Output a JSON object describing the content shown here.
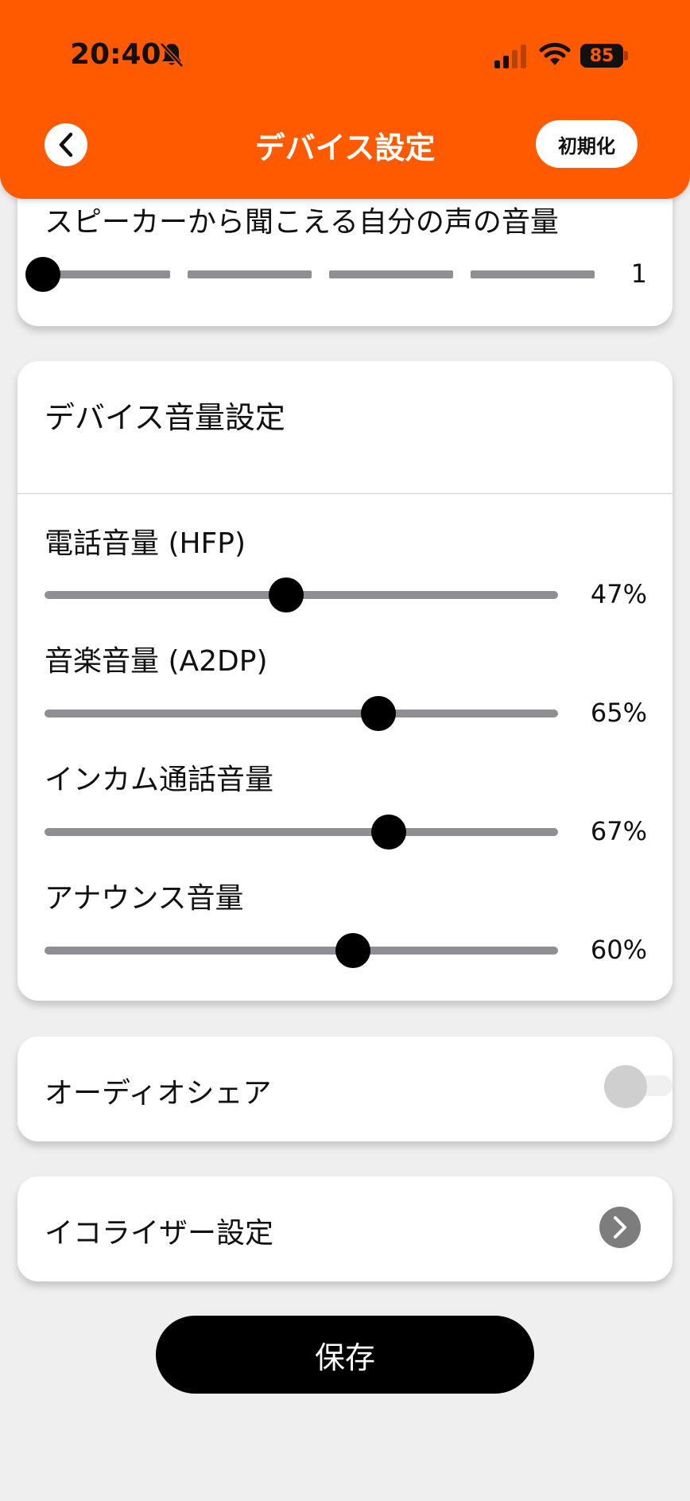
{
  "status_bar": {
    "time": "20:40",
    "silent_icon": "bell-slash-icon",
    "signal_icon": "cellular-signal-icon",
    "wifi_icon": "wifi-icon",
    "battery": "85"
  },
  "header": {
    "title": "デバイス設定",
    "back_icon": "chevron-left-icon",
    "reset_label": "初期化",
    "background_color": "#ff5a00"
  },
  "speaker_card": {
    "label": "スピーカーから聞こえる自分の声の音量",
    "value": "1",
    "level": 1,
    "steps": 5
  },
  "volume_card": {
    "title": "デバイス音量設定",
    "sliders": [
      {
        "label": "電話音量 (HFP)",
        "value_text": "47%",
        "percent": 47
      },
      {
        "label": "音楽音量 (A2DP)",
        "value_text": "65%",
        "percent": 65
      },
      {
        "label": "インカム通話音量",
        "value_text": "67%",
        "percent": 67
      },
      {
        "label": "アナウンス音量",
        "value_text": "60%",
        "percent": 60
      }
    ]
  },
  "audio_share": {
    "label": "オーディオシェア",
    "enabled": false
  },
  "equalizer": {
    "label": "イコライザー設定",
    "icon": "chevron-right-icon"
  },
  "save_button": {
    "label": "保存"
  }
}
